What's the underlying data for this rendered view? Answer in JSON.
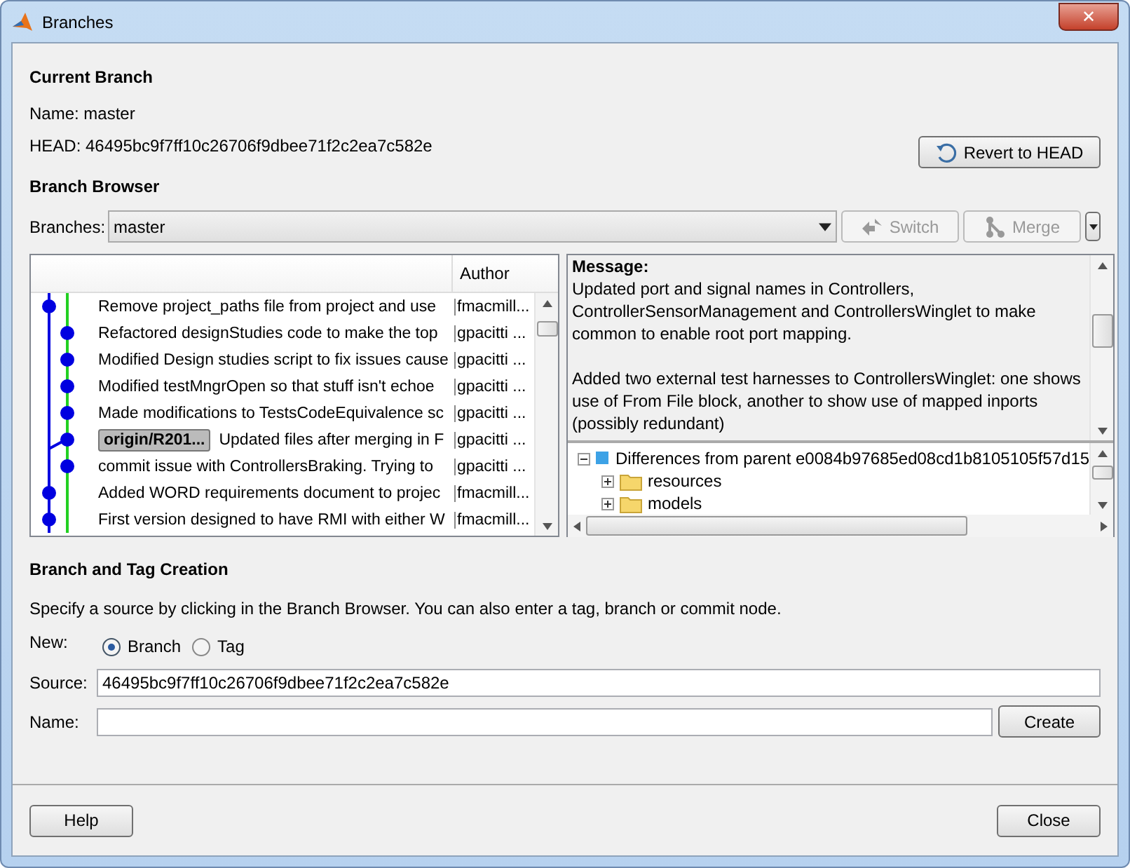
{
  "window": {
    "title": "Branches",
    "close": "✕"
  },
  "current_branch": {
    "heading": "Current Branch",
    "name": "Name: master",
    "head": "HEAD: 46495bc9f7ff10c26706f9dbee71f2c2ea7c582e",
    "revert_button": "Revert to HEAD"
  },
  "branch_browser": {
    "heading": "Branch Browser",
    "branches_label": "Branches:",
    "branches_value": "master",
    "switch_button": "Switch",
    "merge_button": "Merge",
    "columns": [
      "Author"
    ],
    "commits": [
      {
        "kind": "left",
        "message": "Remove project_paths file from project and use",
        "author": "fmacmill..."
      },
      {
        "kind": "right",
        "message": "Refactored designStudies code to make the top",
        "author": "gpacitti ..."
      },
      {
        "kind": "right",
        "message": "Modified Design studies script to fix issues cause",
        "author": "gpacitti ..."
      },
      {
        "kind": "right",
        "message": "Modified testMngrOpen so that stuff isn't echoe",
        "author": "gpacitti ..."
      },
      {
        "kind": "right",
        "message": "Made modifications to TestsCodeEquivalence sc",
        "author": "gpacitti ..."
      },
      {
        "kind": "merge",
        "tag": "origin/R201...",
        "message": "Updated files after merging in F",
        "author": "gpacitti ..."
      },
      {
        "kind": "right",
        "message": "commit issue with ControllersBraking. Trying to",
        "author": "gpacitti ..."
      },
      {
        "kind": "left",
        "message": "Added WORD requirements document to projec",
        "author": "fmacmill..."
      },
      {
        "kind": "left",
        "message": "First version designed to have RMI with either W",
        "author": "fmacmill..."
      }
    ],
    "message_label": "Message:",
    "message_paragraphs": [
      "Updated port and signal names in Controllers, ControllerSensorManagement and ControllersWinglet to make common to enable root port mapping.",
      "Added two external test harnesses to ControllersWinglet: one shows use of From File block, another to show use of mapped inports (possibly redundant)"
    ],
    "tree": [
      {
        "label": "Differences from parent e0084b97685ed08cd1b8105105f57d15",
        "expanded": true,
        "children": [
          {
            "label": "resources",
            "expanded": false
          },
          {
            "label": "models",
            "expanded": false
          }
        ]
      }
    ]
  },
  "creation": {
    "heading": "Branch and Tag Creation",
    "hint": "Specify a source by clicking in the Branch Browser. You can also enter a tag, branch or commit node.",
    "new_label": "New:",
    "options": [
      {
        "label": "Branch",
        "selected": true
      },
      {
        "label": "Tag",
        "selected": false
      }
    ],
    "source_label": "Source:",
    "source_value": "46495bc9f7ff10c26706f9dbee71f2c2ea7c582e",
    "name_label": "Name:",
    "create_button": "Create"
  },
  "buttons": [
    "Help",
    "Close"
  ]
}
